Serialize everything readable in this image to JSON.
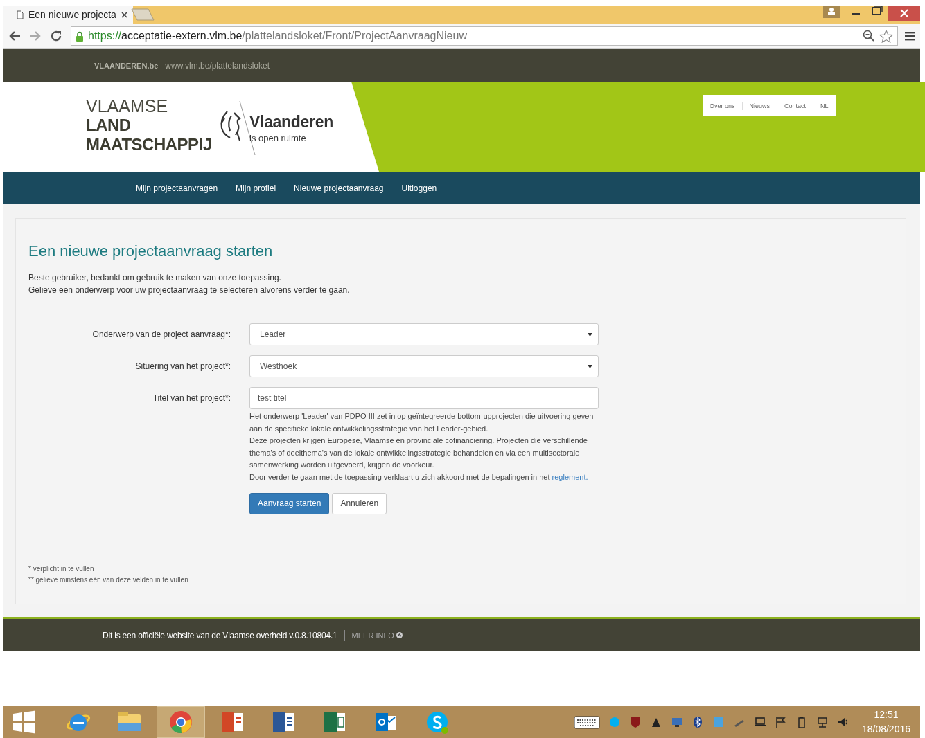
{
  "browser": {
    "tab_title": "Een nieuwe projecta",
    "url": {
      "scheme": "https://",
      "host": "acceptatie-extern.vlm.be",
      "path": "/plattelandsloket/Front/ProjectAanvraagNieuw"
    }
  },
  "topbar": {
    "brand": "VLAANDEREN.be",
    "link": "www.vlm.be/plattelandsloket"
  },
  "header": {
    "logo_lines": [
      "VLAAMSE",
      "LAND",
      "MAATSCHAPPIJ"
    ],
    "region": "Vlaanderen",
    "tagline": "is open ruimte",
    "utility_links": [
      "Over ons",
      "Nieuws",
      "Contact",
      "NL"
    ]
  },
  "nav": [
    "Mijn projectaanvragen",
    "Mijn profiel",
    "Nieuwe projectaanvraag",
    "Uitloggen"
  ],
  "form": {
    "title": "Een nieuwe projectaanvraag starten",
    "intro": [
      "Beste gebruiker, bedankt om gebruik te maken van onze toepassing.",
      "Gelieve een onderwerp voor uw projectaanvraag te selecteren alvorens verder te gaan."
    ],
    "fields": [
      {
        "label": "Onderwerp van de project aanvraag*:",
        "kind": "select",
        "value": "Leader"
      },
      {
        "label": "Situering van het project*:",
        "kind": "select",
        "value": "Westhoek"
      },
      {
        "label": "Titel van het project*:",
        "kind": "text",
        "value": "test titel"
      }
    ],
    "info": [
      "Het onderwerp 'Leader' van PDPO III zet in op geïntegreerde bottom-upprojecten die uitvoering geven aan de specifieke lokale ontwikkelingsstrategie van het Leader-gebied.",
      "Deze projecten krijgen Europese, Vlaamse en provinciale cofinanciering. Projecten die verschillende thema's of deelthema's van de lokale ontwikkelingsstrategie behandelen en via een multisectorale samenwerking worden uitgevoerd, krijgen de voorkeur.",
      "Door verder te gaan met de toepassing verklaart u zich akkoord met de bepalingen in het "
    ],
    "info_link": "reglement.",
    "buttons": [
      {
        "label": "Aanvraag starten",
        "kind": "primary"
      },
      {
        "label": "Annuleren",
        "kind": "default"
      }
    ],
    "footnotes": [
      "* verplicht in te vullen",
      "** gelieve minstens één van deze velden in te vullen"
    ]
  },
  "footer": {
    "text": "Dit is een officiële website van de Vlaamse overheid v.0.8.10804.1",
    "more": "MEER INFO"
  },
  "taskbar": {
    "apps": [
      {
        "kind": "ie",
        "selected": false
      },
      {
        "kind": "explorer",
        "selected": false
      },
      {
        "kind": "chrome",
        "selected": true
      },
      {
        "kind": "powerpoint",
        "selected": false
      },
      {
        "kind": "word",
        "selected": false
      },
      {
        "kind": "excel",
        "selected": false
      },
      {
        "kind": "outlook",
        "selected": false
      },
      {
        "kind": "skype",
        "selected": false
      }
    ],
    "time": "12:51",
    "date": "18/08/2016"
  }
}
